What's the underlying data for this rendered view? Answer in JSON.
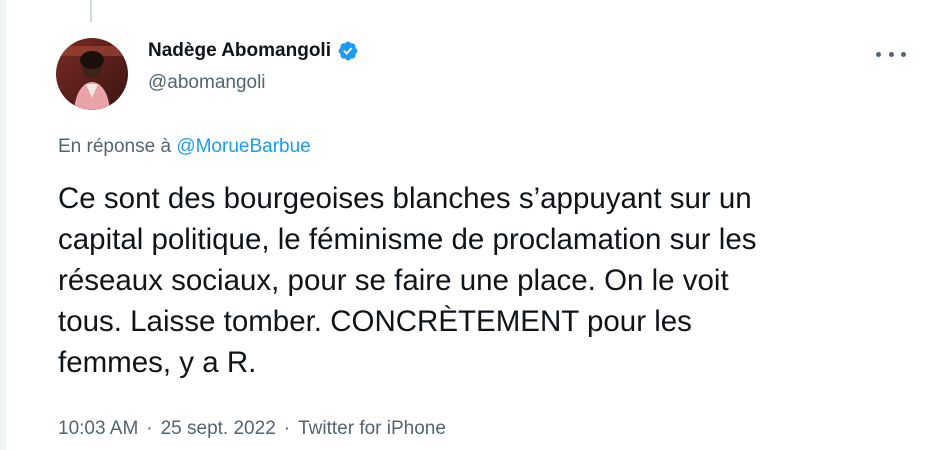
{
  "tweet": {
    "author": {
      "display_name": "Nadège Abomangoli",
      "handle": "@abomangoli",
      "verified": true
    },
    "reply_prefix": "En réponse à",
    "reply_to": "@MorueBarbue",
    "text": "Ce sont des bourgeoises blanches s’appuyant sur un\ncapital politique, le féminisme de proclamation sur les\nréseaux sociaux, pour se faire une place. On le voit\ntous. Laisse tomber. CONCRÈTEMENT pour les\nfemmes, y a R.",
    "time": "10:03 AM",
    "separator": "·",
    "date": "25 sept. 2022",
    "source": "Twitter for iPhone"
  },
  "colors": {
    "accent": "#1d9bf0",
    "text": "#0f1419",
    "secondary": "#536471"
  },
  "icons": {
    "verified": "verified-badge-icon",
    "more": "more-options-icon"
  }
}
